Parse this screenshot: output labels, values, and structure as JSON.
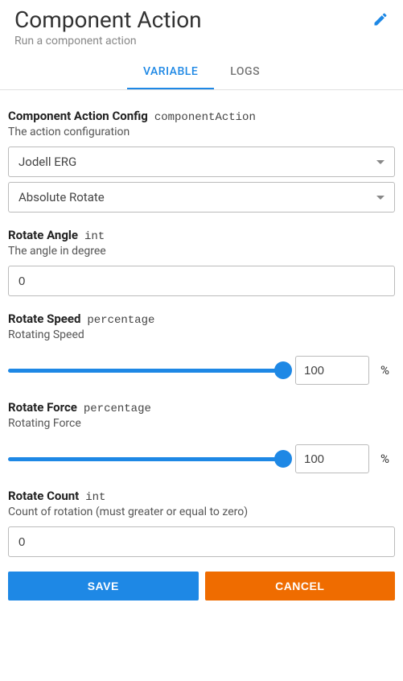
{
  "header": {
    "title": "Component Action",
    "subtitle": "Run a component action"
  },
  "tabs": {
    "variable": "VARIABLE",
    "logs": "LOGS",
    "active": "variable"
  },
  "config": {
    "label": "Component Action Config",
    "type": "componentAction",
    "desc": "The action configuration",
    "selects": {
      "device": "Jodell ERG",
      "action": "Absolute Rotate"
    }
  },
  "rotateAngle": {
    "label": "Rotate Angle",
    "type": "int",
    "desc": "The angle in degree",
    "value": "0"
  },
  "rotateSpeed": {
    "label": "Rotate Speed",
    "type": "percentage",
    "desc": "Rotating Speed",
    "value": "100",
    "unit": "%",
    "percent": 100
  },
  "rotateForce": {
    "label": "Rotate Force",
    "type": "percentage",
    "desc": "Rotating Force",
    "value": "100",
    "unit": "%",
    "percent": 100
  },
  "rotateCount": {
    "label": "Rotate Count",
    "type": "int",
    "desc": "Count of rotation (must greater or equal to zero)",
    "value": "0"
  },
  "buttons": {
    "save": "SAVE",
    "cancel": "CANCEL"
  }
}
